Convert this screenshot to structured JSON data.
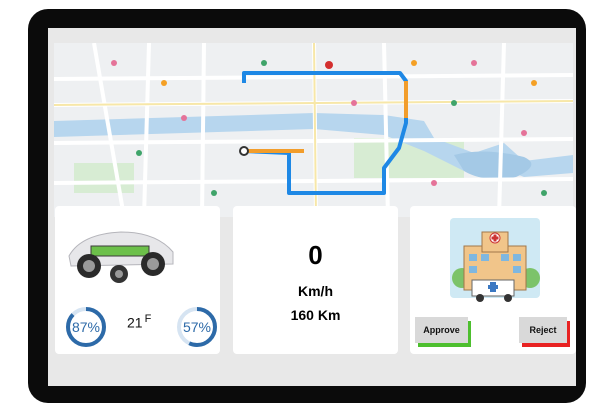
{
  "map": {
    "label": "route-map",
    "colors": {
      "route": "#1e88e5",
      "route_alt": "#f29d2b",
      "water": "#a9cce8",
      "road": "#ffffff",
      "park": "#cde9c9"
    }
  },
  "vehicle": {
    "battery_percent": "87%",
    "battery_value": 0.87,
    "temperature_value": "21",
    "temperature_unit": "F",
    "charge_percent": "57%",
    "charge_value": 0.57
  },
  "speed": {
    "value": "0",
    "unit": "Km/h",
    "distance": "160 Km"
  },
  "hospital": {
    "approve_label": "Approve",
    "reject_label": "Reject",
    "colors": {
      "approve": "#4dbf2e",
      "reject": "#e82222"
    }
  }
}
